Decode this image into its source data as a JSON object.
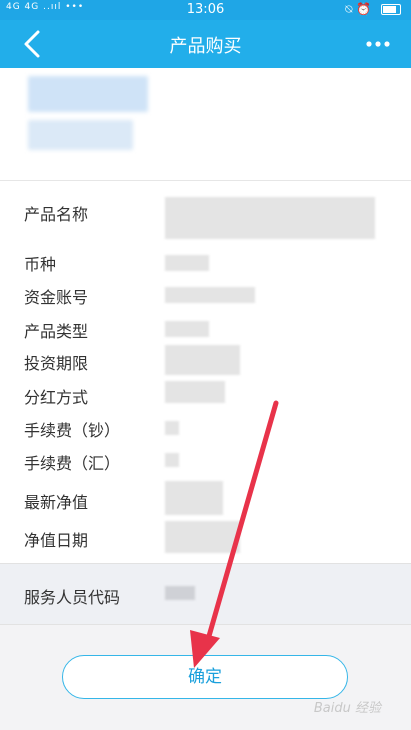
{
  "status_bar": {
    "signal": "4G 4G ..ııl •••",
    "time": "13:06",
    "icons": [
      "alarm-off-icon",
      "alarm-icon",
      "battery-icon"
    ]
  },
  "header": {
    "title": "产品购买"
  },
  "details": {
    "rows": [
      {
        "label": "产品名称"
      },
      {
        "label": "币种"
      },
      {
        "label": "资金账号"
      },
      {
        "label": "产品类型"
      },
      {
        "label": "投资期限"
      },
      {
        "label": "分红方式"
      },
      {
        "label": "手续费（钞）"
      },
      {
        "label": "手续费（汇）"
      },
      {
        "label": "最新净值"
      },
      {
        "label": "净值日期"
      }
    ],
    "service_label": "服务人员代码"
  },
  "actions": {
    "confirm_label": "确定"
  },
  "annotation": {
    "arrow_color": "#e8334a"
  },
  "colors": {
    "accent": "#22aeea",
    "button_text": "#1aa0dc"
  }
}
